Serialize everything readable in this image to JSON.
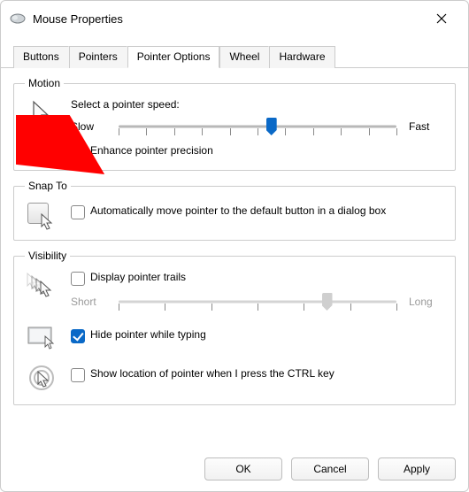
{
  "window": {
    "title": "Mouse Properties"
  },
  "tabs": {
    "buttons": "Buttons",
    "pointers": "Pointers",
    "pointer_options": "Pointer Options",
    "wheel": "Wheel",
    "hardware": "Hardware",
    "active": "pointer_options"
  },
  "motion": {
    "legend": "Motion",
    "speed_label": "Select a pointer speed:",
    "slow": "Slow",
    "fast": "Fast",
    "speed_value_percent": 55,
    "enhance_label": "Enhance pointer precision",
    "enhance_checked": false
  },
  "snap_to": {
    "legend": "Snap To",
    "label": "Automatically move pointer to the default button in a dialog box",
    "checked": false
  },
  "visibility": {
    "legend": "Visibility",
    "trails_label": "Display pointer trails",
    "trails_checked": false,
    "trails_short": "Short",
    "trails_long": "Long",
    "trails_value_percent": 75,
    "hide_label": "Hide pointer while typing",
    "hide_checked": true,
    "ctrl_label": "Show location of pointer when I press the CTRL key",
    "ctrl_checked": false
  },
  "buttons": {
    "ok": "OK",
    "cancel": "Cancel",
    "apply": "Apply"
  }
}
